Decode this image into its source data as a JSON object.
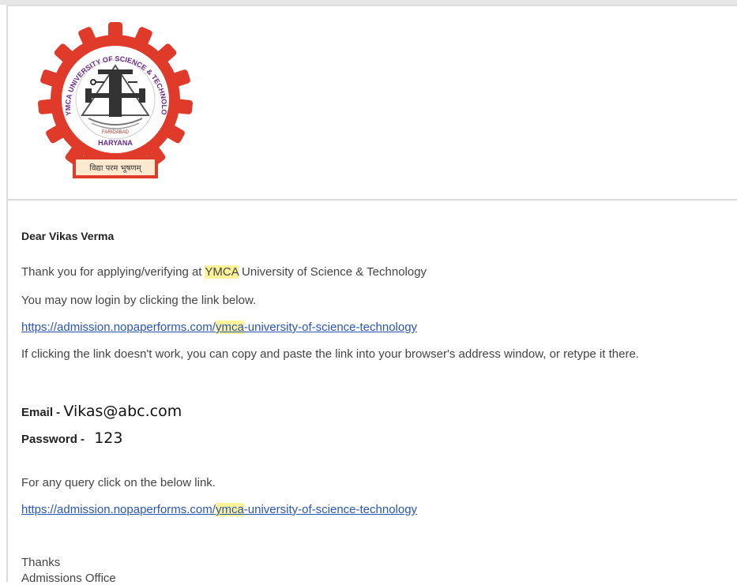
{
  "logo": {
    "arc_text": "YMCA UNIVERSITY OF SCIENCE & TECHNOLOGY",
    "city": "FARIDABAD",
    "state": "HARYANA",
    "motto": "विद्या परम भूषणम्",
    "colors": {
      "gear": "#e03a2b",
      "ring": "#ffffff",
      "motto_box": "#e03a2b",
      "motto_bg": "#fde9cf"
    }
  },
  "email": {
    "greeting": "Dear Vikas Verma",
    "line1_before": "Thank you for applying/verifying at ",
    "line1_highlight": "YMCA",
    "line1_after": " University of Science & Technology",
    "line2": "You may now login by clicking the link below.",
    "link1_before": "https://admission.nopaperforms.com/",
    "link1_highlight": "ymca",
    "link1_after": "-university-of-science-technology",
    "paragraph": "If clicking the link doesn't work, you can copy and paste the link into your browser's address window, or retype it there.",
    "email_label": "Email - ",
    "email_value": "Vikas@abc.com",
    "password_label": "Password - ",
    "password_value": "123",
    "query_line": "For any query click on the below link.",
    "link2_before": "https://admission.nopaperforms.com/",
    "link2_highlight": "ymca",
    "link2_after": "-university-of-science-technology",
    "thanks": "Thanks",
    "office": "Admissions Office"
  },
  "colors": {
    "link": "#2a55b8",
    "highlight": "#fff39a",
    "divider": "#d9d9d9"
  }
}
